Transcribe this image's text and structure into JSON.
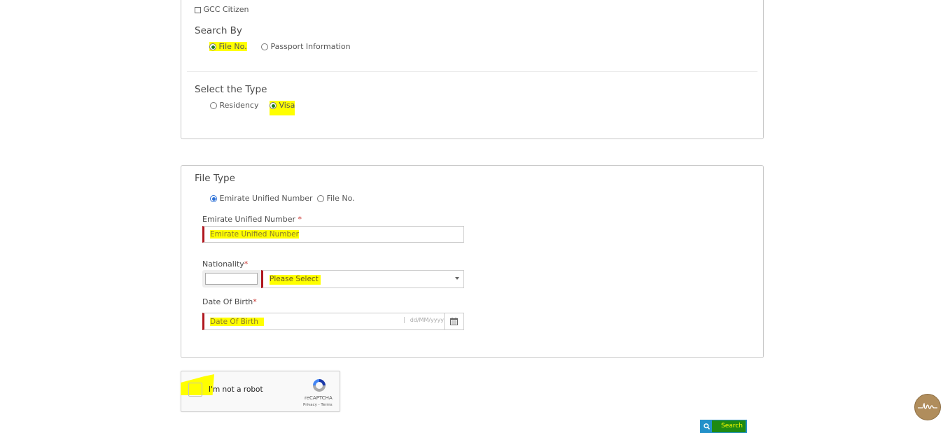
{
  "top_section": {
    "gcc_citizen": {
      "label": "GCC Citizen",
      "checked": false
    },
    "search_by": {
      "title": "Search By",
      "options": [
        {
          "label": "File No.",
          "selected": true
        },
        {
          "label": "Passport Information",
          "selected": false
        }
      ]
    },
    "select_type": {
      "title": "Select the Type",
      "options": [
        {
          "label": "Residency",
          "selected": false
        },
        {
          "label": "Visa",
          "selected": true
        }
      ]
    }
  },
  "file_section": {
    "title": "File Type",
    "options": [
      {
        "label": "Emirate Unified Number",
        "selected": true
      },
      {
        "label": "File No.",
        "selected": false
      }
    ],
    "unified_number": {
      "label": "Emirate Unified Number",
      "required_mark": "*",
      "placeholder": "Emirate Unified Number",
      "value": ""
    },
    "nationality": {
      "label": "Nationality",
      "required_mark": "*",
      "code_value": "",
      "selected": "Please Select"
    },
    "dob": {
      "label": "Date Of Birth",
      "required_mark": "*",
      "placeholder": "Date Of Birth",
      "format_hint": "dd/MM/yyyy"
    }
  },
  "captcha": {
    "label": "I'm not a robot",
    "brand": "reCAPTCHA",
    "links": "Privacy - Terms"
  },
  "search_button": {
    "label": "Search"
  },
  "colors": {
    "highlight": "#ffff00",
    "required": "#b0171f",
    "search_blue": "#2391c9",
    "search_green": "#1f8a12",
    "avatar": "#b08d5c"
  }
}
